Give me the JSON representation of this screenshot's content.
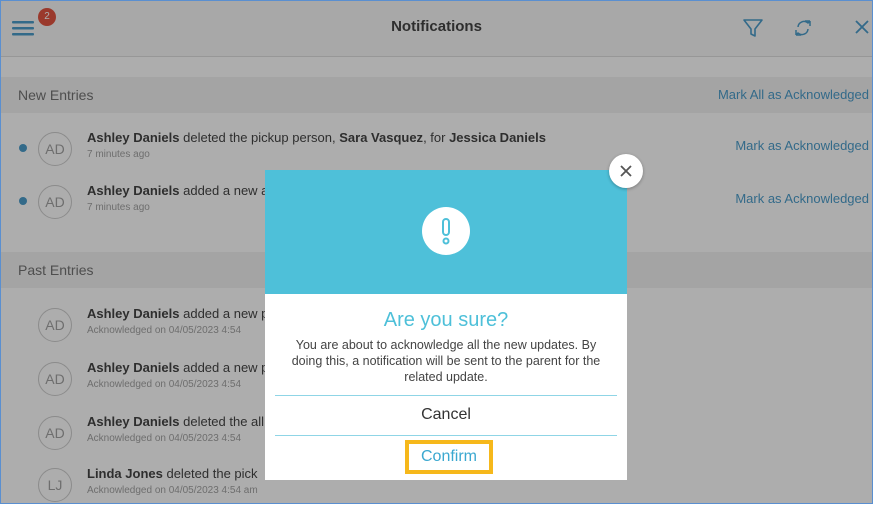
{
  "header": {
    "title": "Notifications",
    "badge_count": "2"
  },
  "new_entries": {
    "title": "New Entries",
    "action_label": "Mark All as Acknowledged",
    "items": [
      {
        "initials": "AD",
        "actor": "Ashley Daniels",
        "pre": " deleted the pickup person, ",
        "bold1": "Sara Vasquez",
        "mid": ", for ",
        "bold2": "Jessica Daniels",
        "post": "",
        "time": "7 minutes ago",
        "action_label": "Mark as Acknowledged"
      },
      {
        "initials": "AD",
        "actor": "Ashley Daniels",
        "pre": " added a new a",
        "bold1": "",
        "mid": "",
        "bold2": "",
        "post": "",
        "time": "7 minutes ago",
        "action_label": "Mark as Acknowledged"
      }
    ]
  },
  "past_entries": {
    "title": "Past Entries",
    "items": [
      {
        "initials": "AD",
        "actor": "Ashley Daniels",
        "rest": " added a new p",
        "time": "Acknowledged on 04/05/2023 4:54"
      },
      {
        "initials": "AD",
        "actor": "Ashley Daniels",
        "rest": " added a new p",
        "time": "Acknowledged on 04/05/2023 4:54"
      },
      {
        "initials": "AD",
        "actor": "Ashley Daniels",
        "rest": " deleted the all",
        "time": "Acknowledged on 04/05/2023 4:54"
      },
      {
        "initials": "LJ",
        "actor": "Linda Jones",
        "rest": " deleted the pick",
        "time": "Acknowledged on 04/05/2023 4:54 am"
      }
    ]
  },
  "modal": {
    "title": "Are you sure?",
    "message": "You are about to acknowledge all the new updates. By doing this, a notification will be sent to the parent for the related update.",
    "cancel_label": "Cancel",
    "confirm_label": "Confirm"
  },
  "colors": {
    "accent": "#3a93c6",
    "modal_header": "#4ec0d9",
    "highlight": "#f6b81b",
    "badge": "#e0452f"
  }
}
